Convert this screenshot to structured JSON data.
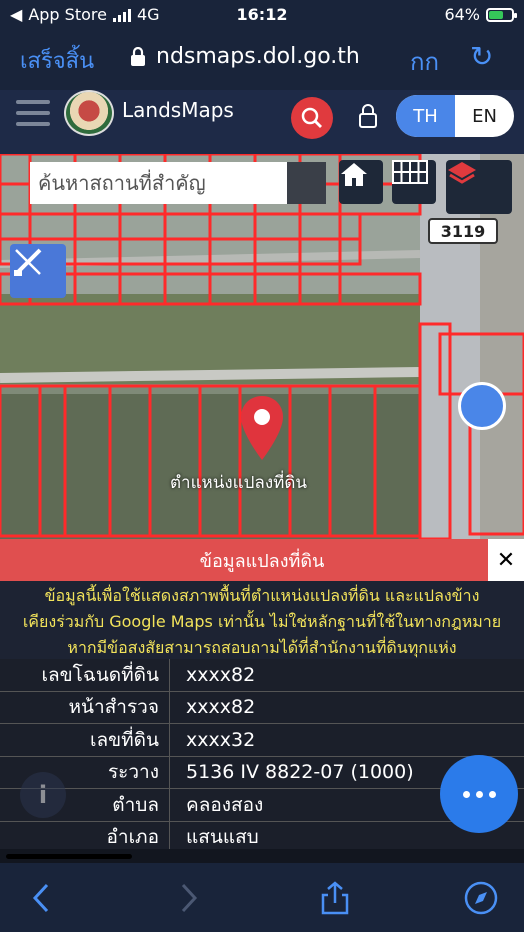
{
  "status": {
    "carrier": "App Store",
    "network": "4G",
    "time": "16:12",
    "battery": "64%",
    "battery_fraction": 0.64
  },
  "browser": {
    "done_label": "เสร็จสิ้น",
    "url": "ndsmaps.dol.go.th",
    "text_size_label": "กก"
  },
  "app": {
    "brand": "LandsMaps",
    "lang_th": "TH",
    "lang_en": "EN"
  },
  "map": {
    "search_placeholder": "ค้นหาสถานที่สำคัญ",
    "road_sign": "3119",
    "marker_label": "ตำแหน่งแปลงที่ดิน"
  },
  "panel": {
    "title": "ข้อมูลแปลงที่ดิน",
    "disclaimer_lines": [
      "ข้อมูลนี้เพื่อใช้แสดงสภาพพื้นที่ตำแหน่งแปลงที่ดิน และแปลงข้าง",
      "เคียงร่วมกับ Google Maps เท่านั้น ไม่ใช่หลักฐานที่ใช้ในทางกฎหมาย",
      "หากมีข้อสงสัยสามารถสอบถามได้ที่สำนักงานที่ดินทุกแห่ง"
    ],
    "rows": [
      {
        "label": "เลขโฉนดที่ดิน",
        "value": "xxxx82"
      },
      {
        "label": "หน้าสำรวจ",
        "value": "xxxx82"
      },
      {
        "label": "เลขที่ดิน",
        "value": "xxxx32"
      },
      {
        "label": "ระวาง",
        "value": "5136 IV 8822-07 (1000)"
      },
      {
        "label": "ตำบล",
        "value": "คลองสอง"
      },
      {
        "label": "อำเภอ",
        "value": "แสนแสบ"
      }
    ]
  },
  "colors": {
    "accent": "#4a86e8",
    "danger": "#e04f4f",
    "parcel_line": "#ff2a2a",
    "disclaimer_text": "#f2e35b"
  },
  "icons": {
    "search": "search-icon",
    "lock": "lock-icon",
    "home": "home-icon",
    "grid": "grid-icon",
    "layers": "layers-icon",
    "draw": "ruler-pencil-icon",
    "more": "more-icon"
  }
}
